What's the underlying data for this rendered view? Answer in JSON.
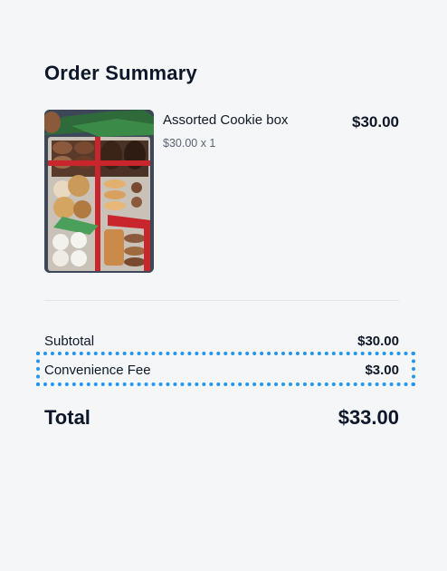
{
  "order": {
    "title": "Order Summary",
    "item": {
      "name": "Assorted Cookie box",
      "unit_line": "$30.00 x 1",
      "price": "$30.00",
      "image_icon": "cookie-box-photo"
    },
    "summary": {
      "subtotal_label": "Subtotal",
      "subtotal_value": "$30.00",
      "fee_label": "Convenience Fee",
      "fee_value": "$3.00",
      "total_label": "Total",
      "total_value": "$33.00"
    }
  },
  "colors": {
    "background": "#f4f6f8",
    "text": "#0f172a",
    "muted": "#5b6472",
    "highlight": "#2196f3"
  }
}
